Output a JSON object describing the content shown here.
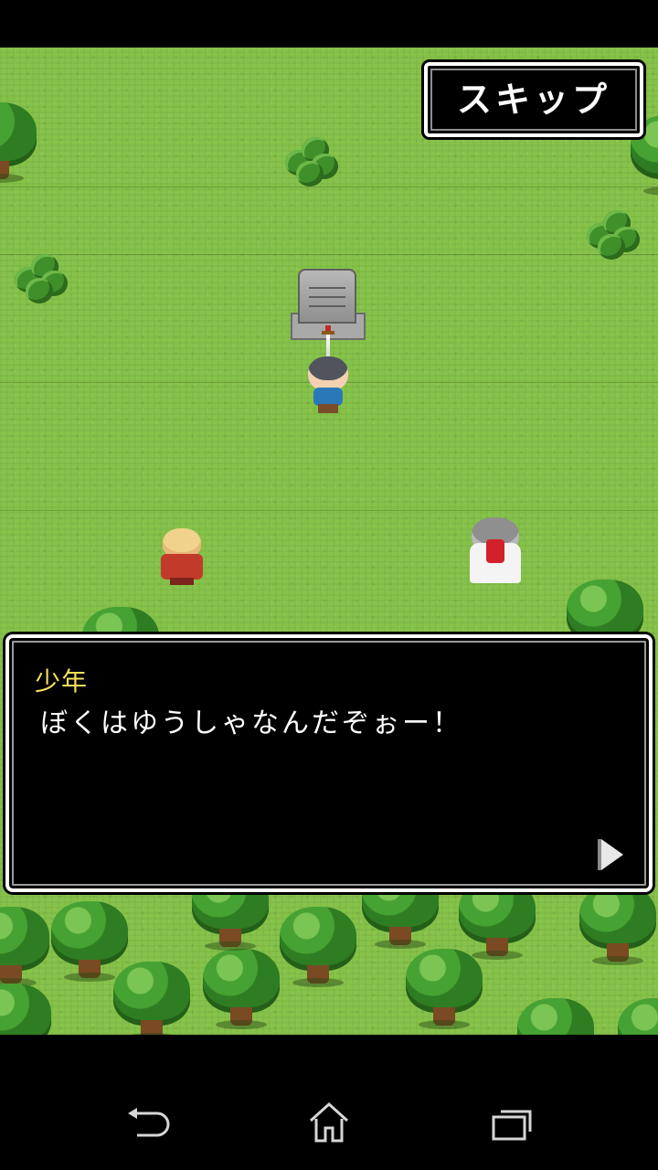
{
  "skip_button": {
    "label": "スキップ"
  },
  "dialog": {
    "speaker": "少年",
    "message": "ぼくはゆうしゃなんだぞぉー！"
  },
  "icons": {
    "advance": "play-triangle-icon",
    "back": "back-arrow-icon",
    "home": "home-icon",
    "recent": "recent-apps-icon"
  },
  "colors": {
    "grass": "#86c34a",
    "speaker_name": "#f7e15a",
    "dialog_bg": "#000000",
    "dialog_border": "#ffffff"
  }
}
